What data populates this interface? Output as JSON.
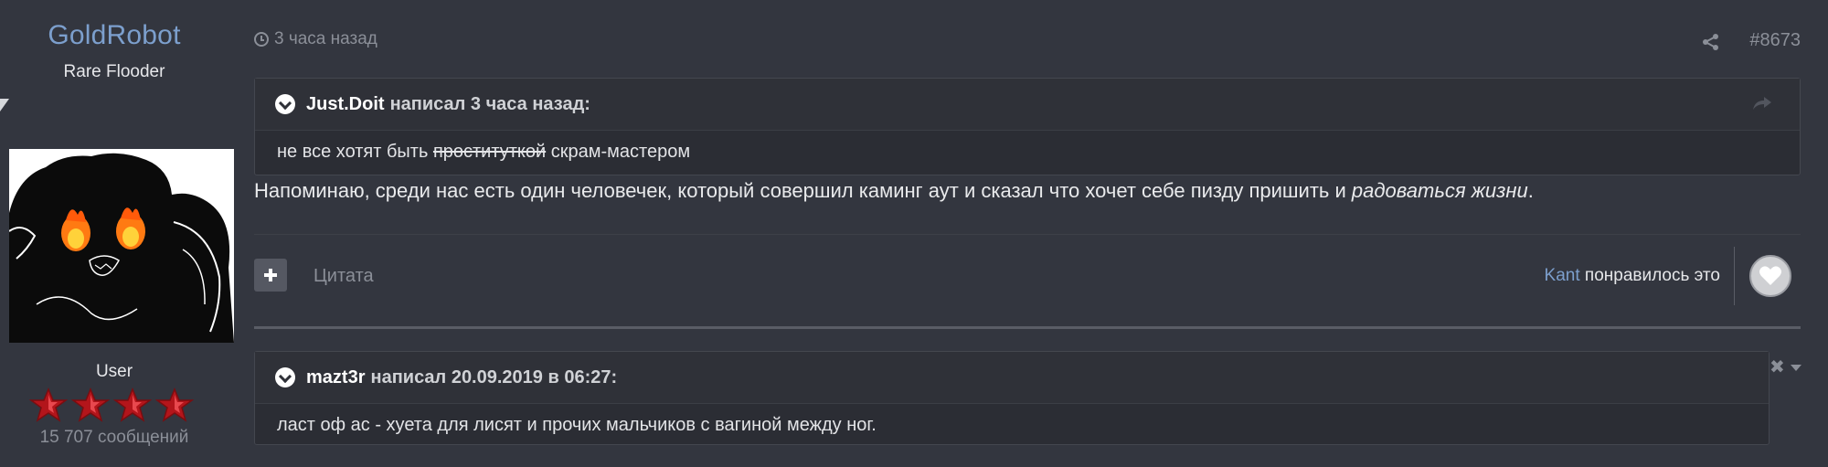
{
  "author": {
    "name": "GoldRobot",
    "title": "Rare Flooder",
    "group": "User",
    "post_count": "15 707 сообщений",
    "rank_icon": "red-star-icon"
  },
  "post": {
    "time": "3 часа назад",
    "number": "#8673",
    "body_prefix": "Напоминаю, среди нас есть один человечек, который совершил каминг аут и сказал что хочет себе пизду пришить и ",
    "body_emphasis": "радоваться жизни",
    "body_suffix": "."
  },
  "quote1": {
    "author": "Just.Doit",
    "meta": "написал 3 часа назад:",
    "text_before": "не все хотят быть ",
    "text_struck": "проституткой",
    "text_after": " скрам-мастером"
  },
  "actions": {
    "quote_label": "Цитата",
    "liker": "Kant",
    "liked_text": "понравилось это"
  },
  "quote2": {
    "author": "mazt3r",
    "meta": "написал 20.09.2019 в 06:27:",
    "text": "ласт оф ас - хуета для лисят и прочих мальчиков с вагиной между ног."
  },
  "colors": {
    "background": "#33363f",
    "link": "#7c9fcd",
    "muted": "#8b8f98"
  }
}
